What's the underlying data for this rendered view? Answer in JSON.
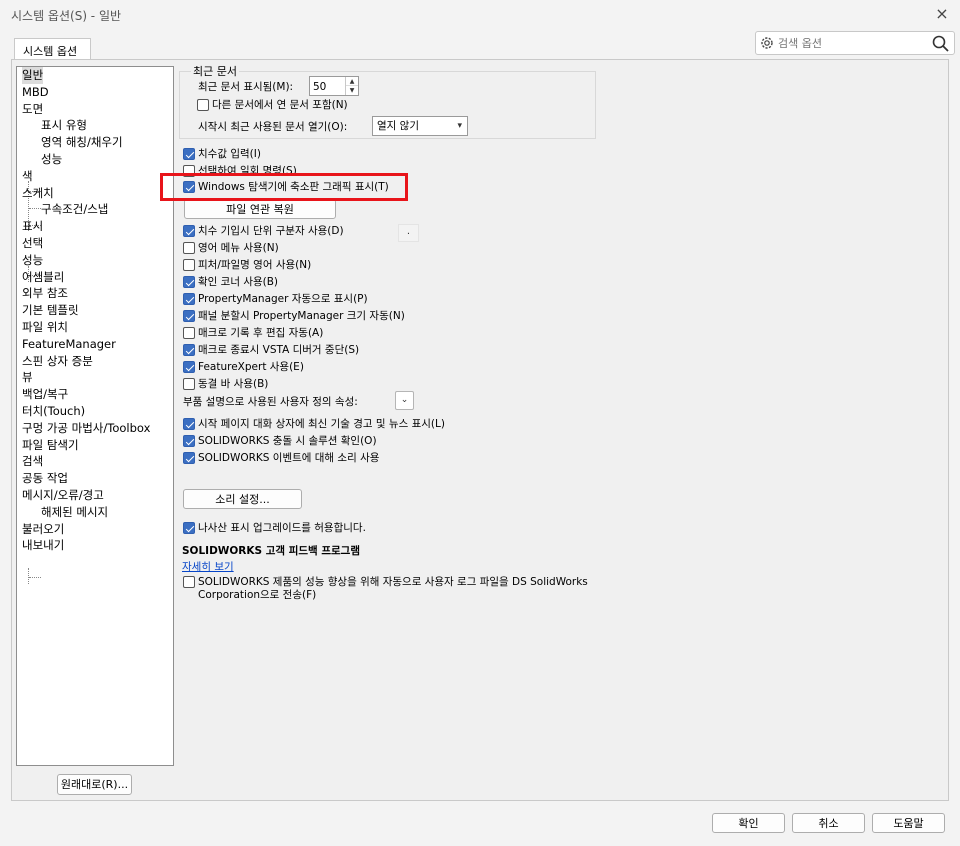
{
  "window": {
    "title": "시스템 옵션(S) - 일반",
    "close_icon": "×"
  },
  "tabs": [
    {
      "label": "시스템 옵션(S)"
    }
  ],
  "search": {
    "placeholder": "검색 옵션"
  },
  "tree": {
    "items": [
      {
        "label": "일반",
        "selected": true,
        "sub": false
      },
      {
        "label": "MBD",
        "sub": false
      },
      {
        "label": "도면",
        "sub": false
      },
      {
        "label": "표시 유형",
        "sub": true
      },
      {
        "label": "영역 해칭/채우기",
        "sub": true
      },
      {
        "label": "성능",
        "sub": true
      },
      {
        "label": "색",
        "sub": false
      },
      {
        "label": "스케치",
        "sub": false
      },
      {
        "label": "구속조건/스냅",
        "sub": true
      },
      {
        "label": "표시",
        "sub": false
      },
      {
        "label": "선택",
        "sub": false
      },
      {
        "label": "성능",
        "sub": false
      },
      {
        "label": "어셈블리",
        "sub": false
      },
      {
        "label": "외부 참조",
        "sub": false
      },
      {
        "label": "기본 템플릿",
        "sub": false
      },
      {
        "label": "파일 위치",
        "sub": false
      },
      {
        "label": "FeatureManager",
        "sub": false
      },
      {
        "label": "스핀 상자 증분",
        "sub": false
      },
      {
        "label": "뷰",
        "sub": false
      },
      {
        "label": "백업/복구",
        "sub": false
      },
      {
        "label": "터치(Touch)",
        "sub": false
      },
      {
        "label": "구멍 가공 마법사/Toolbox",
        "sub": false
      },
      {
        "label": "파일 탐색기",
        "sub": false
      },
      {
        "label": "검색",
        "sub": false
      },
      {
        "label": "공동 작업",
        "sub": false
      },
      {
        "label": "메시지/오류/경고",
        "sub": false
      },
      {
        "label": "해제된 메시지",
        "sub": true
      },
      {
        "label": "불러오기",
        "sub": false
      },
      {
        "label": "내보내기",
        "sub": false
      }
    ],
    "reset_label": "원래대로(R)..."
  },
  "recent": {
    "group_title": "최근 문서",
    "max_label": "최근 문서 표시됨(M):",
    "max_value": "50",
    "other_folders_label": "다른 문서에서 연 문서 포함(N)",
    "other_folders_checked": false,
    "startup_label": "시작시 최근 사용된 문서 열기(O):",
    "startup_value": "열지 않기"
  },
  "options": [
    {
      "label": "치수값 입력(I)",
      "checked": true
    },
    {
      "label": "선택하여 일회 명령(S)",
      "checked": false
    },
    {
      "label": "Windows 탐색기에 축소판 그래픽 표시(T)",
      "checked": true,
      "highlighted": true
    }
  ],
  "file_assoc_button": "파일 연관 복원",
  "options2": [
    {
      "label": "치수 기입시 단위 구분자 사용(D)",
      "checked": true
    },
    {
      "label": "영어 메뉴 사용(N)",
      "checked": false
    },
    {
      "label": "피처/파일명 영어 사용(N)",
      "checked": false
    },
    {
      "label": "확인 코너 사용(B)",
      "checked": true
    },
    {
      "label": "PropertyManager 자동으로 표시(P)",
      "checked": true
    },
    {
      "label": "패널 분할시 PropertyManager 크기 자동(N)",
      "checked": true
    },
    {
      "label": "매크로 기록 후 편집 자동(A)",
      "checked": false
    },
    {
      "label": "매크로 종료시 VSTA 디버거 중단(S)",
      "checked": true
    },
    {
      "label": "FeatureXpert 사용(E)",
      "checked": true
    },
    {
      "label": "동결 바 사용(B)",
      "checked": false
    }
  ],
  "separator_box": ".",
  "custom_prop_label": "부품 설명으로 사용된 사용자 정의 속성:",
  "options3": [
    {
      "label": "시작 페이지 대화 상자에 최신 기술 경고 및 뉴스 표시(L)",
      "checked": true
    },
    {
      "label": "SOLIDWORKS 충돌 시 솔루션 확인(O)",
      "checked": true
    },
    {
      "label": "SOLIDWORKS 이벤트에 대해 소리 사용",
      "checked": true
    }
  ],
  "sound_button": "소리 설정...",
  "upgrade": {
    "label": "나사산 표시 업그레이드를 허용합니다.",
    "checked": true
  },
  "feedback": {
    "heading": "SOLIDWORKS 고객 피드백 프로그램",
    "link": "자세히 보기",
    "label_line1": "SOLIDWORKS 제품의 성능 향상을 위해 자동으로 사용자 로그 파일을 DS SolidWorks",
    "label_line2": "Corporation으로 전송(F)",
    "checked": false
  },
  "footer": {
    "ok": "확인",
    "cancel": "취소",
    "help": "도움말"
  },
  "colors": {
    "accent": "#3b6fc2",
    "highlight": "#e8141a",
    "link": "#0645c8"
  }
}
